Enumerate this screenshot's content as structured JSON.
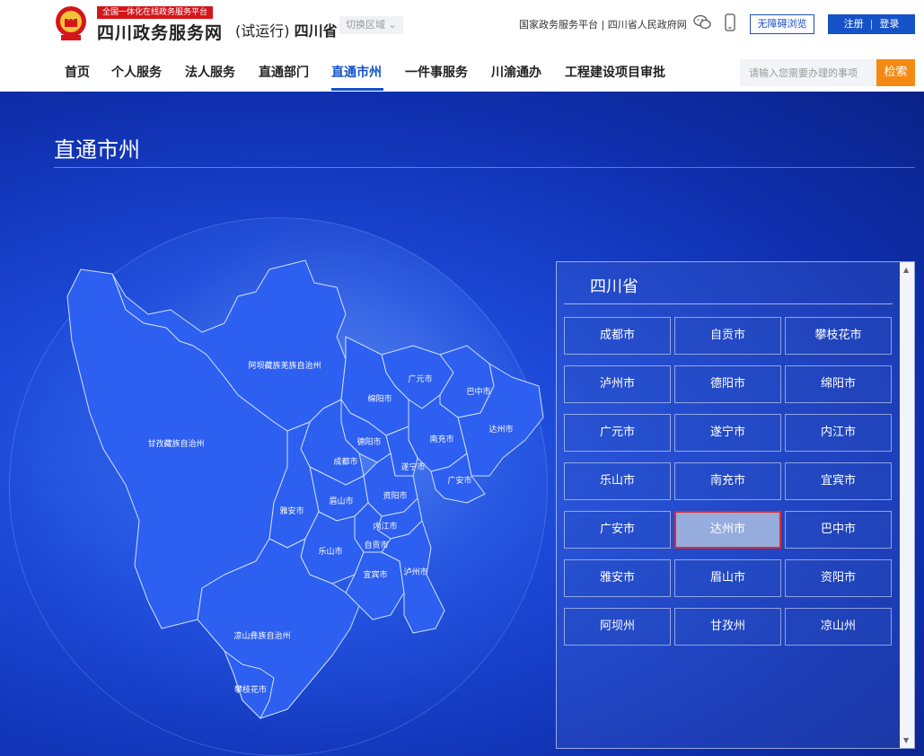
{
  "header": {
    "tagline": "全国一体化在线政务服务平台",
    "site_name": "四川政务服务网",
    "trial_label": "(试运行)",
    "province": "四川省",
    "region_switch": "切换区域",
    "top_links": "国家政务服务平台 | 四川省人民政府网",
    "accessible": "无障碍浏览",
    "register": "注册",
    "divider": "|",
    "login": "登录",
    "icons": [
      "national-emblem-icon",
      "wechat-icon",
      "mobile-icon",
      "chevron-down-icon"
    ]
  },
  "nav": {
    "items": [
      "首页",
      "个人服务",
      "法人服务",
      "直通部门",
      "直通市州",
      "一件事服务",
      "川渝通办",
      "工程建设项目审批"
    ],
    "active": "直通市州",
    "search_placeholder": "请输入您需要办理的事项",
    "search_button": "检索"
  },
  "main": {
    "title": "直通市州",
    "map_labels": [
      "阿坝藏族羌族自治州",
      "甘孜藏族自治州",
      "绵阳市",
      "广元市",
      "巴中市",
      "达州市",
      "南充市",
      "德阳市",
      "成都市",
      "遂宁市",
      "广安市",
      "资阳市",
      "眉山市",
      "雅安市",
      "内江市",
      "自贡市",
      "乐山市",
      "宜宾市",
      "泸州市",
      "凉山彝族自治州",
      "攀枝花市"
    ],
    "panel": {
      "province": "四川省",
      "cities": [
        "成都市",
        "自贡市",
        "攀枝花市",
        "泸州市",
        "德阳市",
        "绵阳市",
        "广元市",
        "遂宁市",
        "内江市",
        "乐山市",
        "南充市",
        "宜宾市",
        "广安市",
        "达州市",
        "巴中市",
        "雅安市",
        "眉山市",
        "资阳市",
        "阿坝州",
        "甘孜州",
        "凉山州"
      ],
      "selected": "达州市"
    }
  },
  "colors": {
    "brand_blue": "#1552c8",
    "search_orange": "#f58a12",
    "tag_red": "#d4161b",
    "map_fill": "#2d5ff0",
    "selected_border": "#e02a2a"
  }
}
